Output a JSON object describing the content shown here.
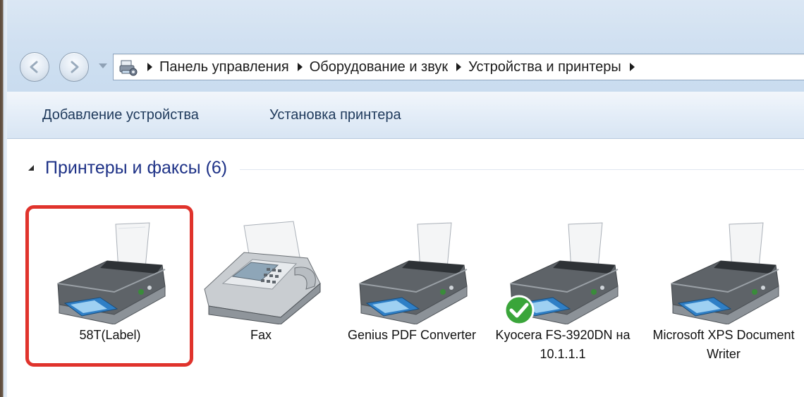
{
  "nav": {
    "back_icon": "back-arrow-icon",
    "forward_icon": "forward-arrow-icon",
    "breadcrumbs": [
      "Панель управления",
      "Оборудование и звук",
      "Устройства и принтеры"
    ]
  },
  "toolbar": {
    "add_device_label": "Добавление устройства",
    "install_printer_label": "Установка принтера"
  },
  "group": {
    "title": "Принтеры и факсы (6)"
  },
  "devices": [
    {
      "label": "58T(Label)",
      "icon": "printer-icon",
      "selected": true
    },
    {
      "label": "Fax",
      "icon": "fax-icon"
    },
    {
      "label": "Genius PDF Converter",
      "icon": "printer-icon"
    },
    {
      "label": "Kyocera FS-3920DN на 10.1.1.1",
      "icon": "printer-icon",
      "default": true
    },
    {
      "label": "Microsoft XPS Document Writer",
      "icon": "printer-icon"
    }
  ],
  "colors": {
    "selection_outline": "#e0332c",
    "group_title": "#1e3287",
    "toolbar_text": "#1e395b"
  }
}
